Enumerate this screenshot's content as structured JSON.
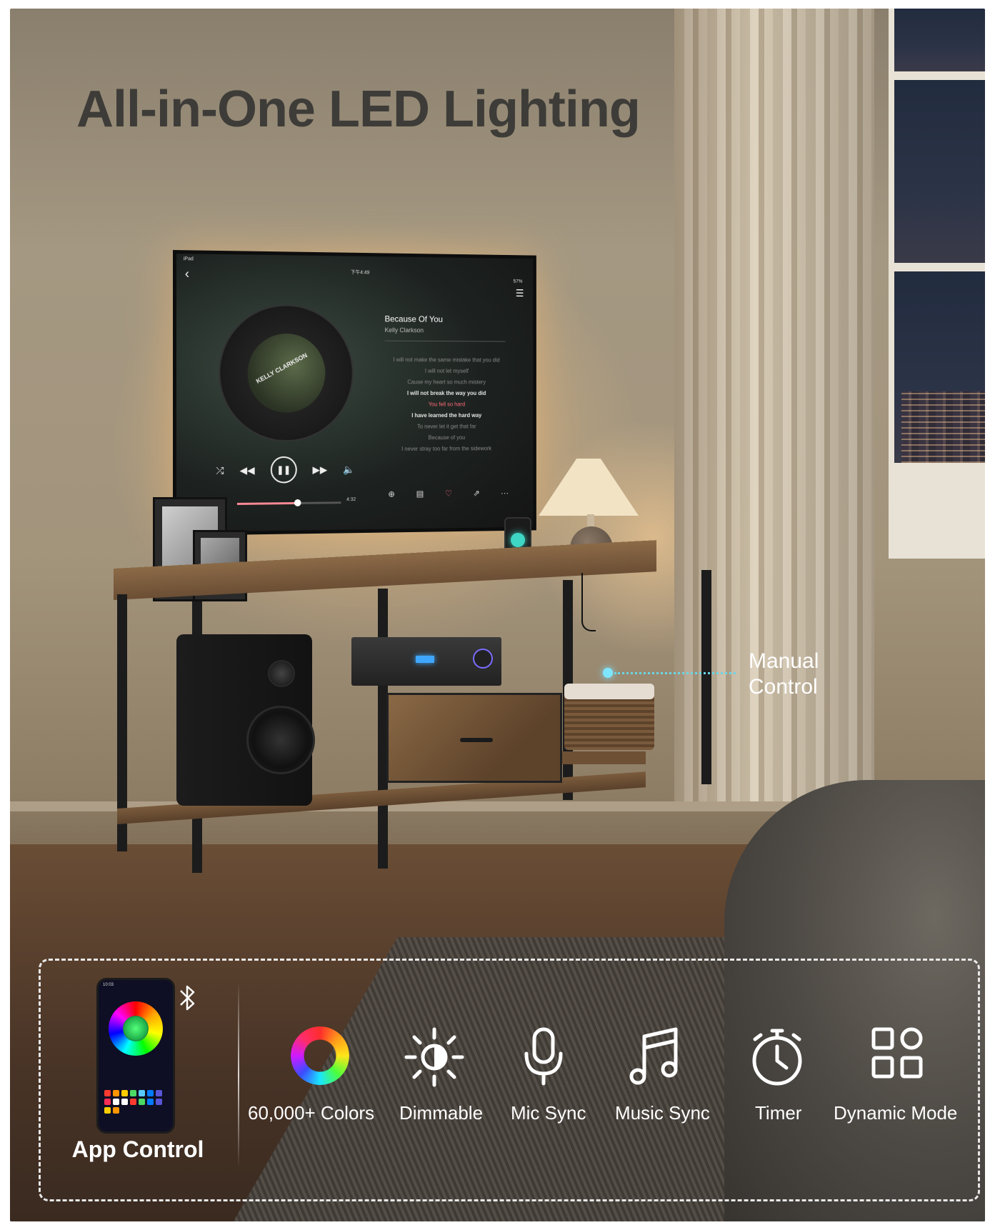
{
  "title": "All-in-One LED Lighting",
  "tv_screen": {
    "status_left": "iPad",
    "time": "下午4:49",
    "battery": "57%",
    "song_title": "Because Of You",
    "artist": "Kelly Clarkson",
    "album_text": "KELLY CLARKSON",
    "lyrics": [
      "I will not make the same mistake that you did",
      "I will not let myself",
      "Cause my heart so much mistery",
      "I will not break the way you did",
      "You fell so hard",
      "I have learned the hard way",
      "To never let it get that far",
      "Because of you",
      "I never stray too far from the sidework"
    ],
    "duration": "4:32",
    "progress": 0.58
  },
  "manual_control": {
    "line1": "Manual",
    "line2": "Control"
  },
  "app_control": {
    "label": "App Control",
    "phone_time": "10:03"
  },
  "features": [
    {
      "label": "60,000+ Colors",
      "icon": "color-ring-icon"
    },
    {
      "label": "Dimmable",
      "icon": "brightness-icon"
    },
    {
      "label": "Mic Sync",
      "icon": "microphone-icon"
    },
    {
      "label": "Music Sync",
      "icon": "music-note-icon"
    },
    {
      "label": "Timer",
      "icon": "timer-icon"
    },
    {
      "label": "Dynamic Mode",
      "icon": "grid-icon"
    }
  ],
  "colors": {
    "accent": "#7fe6ff",
    "panel_border": "#e8e8e8",
    "title": "#3e3c38"
  }
}
